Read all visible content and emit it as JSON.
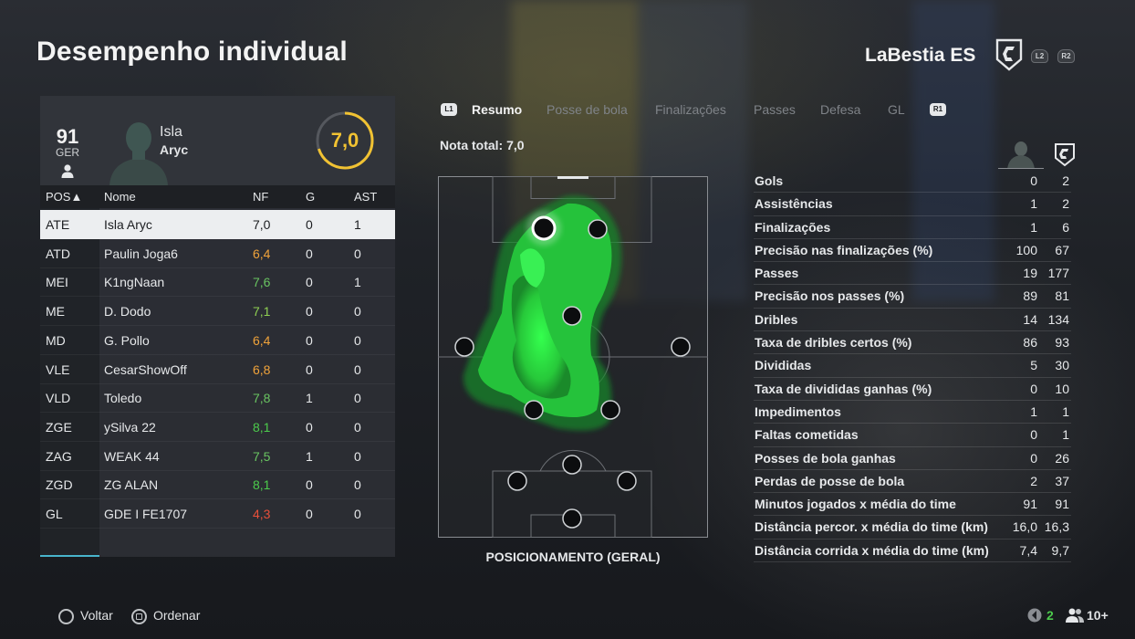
{
  "header": {
    "title": "Desempenho individual",
    "team_name": "LaBestia ES",
    "btn_l2": "L2",
    "btn_r2": "R2"
  },
  "player_card": {
    "overall": "91",
    "country": "GER",
    "first_name": "Isla",
    "last_name": "Aryc",
    "rating": "7,0"
  },
  "table": {
    "headers": {
      "pos": "POS▲",
      "name": "Nome",
      "nf": "NF",
      "g": "G",
      "ast": "AST"
    },
    "rows": [
      {
        "pos": "ATE",
        "name": "Isla Aryc",
        "nf": "7,0",
        "g": "0",
        "ast": "1",
        "nf_color": "#1b1d20"
      },
      {
        "pos": "ATD",
        "name": "Paulin Joga6",
        "nf": "6,4",
        "g": "0",
        "ast": "0",
        "nf_color": "#f0a33a"
      },
      {
        "pos": "MEI",
        "name": "K1ngNaan",
        "nf": "7,6",
        "g": "0",
        "ast": "1",
        "nf_color": "#69c461"
      },
      {
        "pos": "ME",
        "name": "D. Dodo",
        "nf": "7,1",
        "g": "0",
        "ast": "0",
        "nf_color": "#8fcf52"
      },
      {
        "pos": "MD",
        "name": "G. Pollo",
        "nf": "6,4",
        "g": "0",
        "ast": "0",
        "nf_color": "#f0a33a"
      },
      {
        "pos": "VLE",
        "name": "CesarShowOff",
        "nf": "6,8",
        "g": "0",
        "ast": "0",
        "nf_color": "#f0a33a"
      },
      {
        "pos": "VLD",
        "name": "Toledo",
        "nf": "7,8",
        "g": "1",
        "ast": "0",
        "nf_color": "#69c461"
      },
      {
        "pos": "ZGE",
        "name": "ySilva 22",
        "nf": "8,1",
        "g": "0",
        "ast": "0",
        "nf_color": "#4ccb4c"
      },
      {
        "pos": "ZAG",
        "name": "WEAK 44",
        "nf": "7,5",
        "g": "1",
        "ast": "0",
        "nf_color": "#69c461"
      },
      {
        "pos": "ZGD",
        "name": "ZG ALAN",
        "nf": "8,1",
        "g": "0",
        "ast": "0",
        "nf_color": "#4ccb4c"
      },
      {
        "pos": "GL",
        "name": "GDE I FE1707",
        "nf": "4,3",
        "g": "0",
        "ast": "0",
        "nf_color": "#e8503a"
      }
    ]
  },
  "tabs": {
    "l1": "L1",
    "r1": "R1",
    "items": [
      "Resumo",
      "Posse de bola",
      "Finalizações",
      "Passes",
      "Defesa",
      "GL"
    ],
    "active": 0
  },
  "summary": {
    "total_rating_label": "Nota total: 7,0",
    "pitch_label": "POSICIONAMENTO (GERAL)"
  },
  "stats": [
    {
      "label": "Gols",
      "player": "0",
      "team": "2"
    },
    {
      "label": "Assistências",
      "player": "1",
      "team": "2"
    },
    {
      "label": "Finalizações",
      "player": "1",
      "team": "6"
    },
    {
      "label": "Precisão nas finalizações (%)",
      "player": "100",
      "team": "67"
    },
    {
      "label": "Passes",
      "player": "19",
      "team": "177"
    },
    {
      "label": "Precisão nos passes (%)",
      "player": "89",
      "team": "81"
    },
    {
      "label": "Dribles",
      "player": "14",
      "team": "134"
    },
    {
      "label": "Taxa de dribles certos (%)",
      "player": "86",
      "team": "93"
    },
    {
      "label": "Divididas",
      "player": "5",
      "team": "30"
    },
    {
      "label": "Taxa de divididas ganhas (%)",
      "player": "0",
      "team": "10"
    },
    {
      "label": "Impedimentos",
      "player": "1",
      "team": "1"
    },
    {
      "label": "Faltas cometidas",
      "player": "0",
      "team": "1"
    },
    {
      "label": "Posses de bola ganhas",
      "player": "0",
      "team": "26"
    },
    {
      "label": "Perdas de posse de bola",
      "player": "2",
      "team": "37"
    },
    {
      "label": "Minutos jogados x média do time",
      "player": "91",
      "team": "91"
    },
    {
      "label": "Distância percor. x média do time (km)",
      "player": "16,0",
      "team": "16,3"
    },
    {
      "label": "Distância corrida x média do time (km)",
      "player": "7,4",
      "team": "9,7"
    }
  ],
  "footer": {
    "back": "Voltar",
    "sort": "Ordenar",
    "party_count": "2",
    "players_online": "10+"
  },
  "colors": {
    "rating_ring": "#f1c232",
    "heat": "#2fd64a",
    "selection_bar": "#48b4cc"
  }
}
